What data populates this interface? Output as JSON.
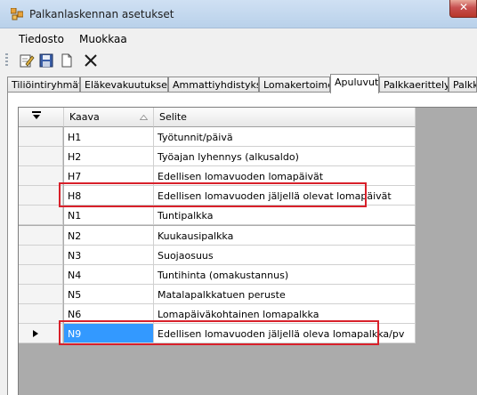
{
  "window": {
    "title": "Palkanlaskennan asetukset"
  },
  "menu": [
    "Tiedosto",
    "Muokkaa"
  ],
  "toolbar": [
    {
      "icon": "edit-icon"
    },
    {
      "icon": "save-icon"
    },
    {
      "icon": "new-document-icon"
    },
    {
      "icon": "delete-icon"
    }
  ],
  "tabs": [
    {
      "label": "Tiliöintiryhmät",
      "active": false
    },
    {
      "label": "Eläkevakuutukset",
      "active": false
    },
    {
      "label": "Ammattiyhdistykset",
      "active": false
    },
    {
      "label": "Lomakertoimet",
      "active": false
    },
    {
      "label": "Apuluvut",
      "active": true
    },
    {
      "label": "Palkkaerittely",
      "active": false
    },
    {
      "label": "Palkka",
      "active": false
    }
  ],
  "grid": {
    "columns": [
      {
        "label": "Kaava",
        "sort": "ascending"
      },
      {
        "label": "Selite"
      }
    ],
    "rows": [
      {
        "kaava": "H1",
        "selite": "Työtunnit/päivä"
      },
      {
        "kaava": "H2",
        "selite": "Työajan lyhennys (alkusaldo)"
      },
      {
        "kaava": "H7",
        "selite": "Edellisen lomavuoden lomapäivät"
      },
      {
        "kaava": "H8",
        "selite": "Edellisen lomavuoden jäljellä olevat lomapäivät",
        "highlighted": true
      },
      {
        "kaava": "N1",
        "selite": "Tuntipalkka"
      },
      {
        "kaava": "N2",
        "selite": "Kuukausipalkka"
      },
      {
        "kaava": "N3",
        "selite": "Suojaosuus"
      },
      {
        "kaava": "N4",
        "selite": "Tuntihinta (omakustannus)"
      },
      {
        "kaava": "N5",
        "selite": "Matalapalkkatuen peruste"
      },
      {
        "kaava": "N6",
        "selite": "Lomapäiväkohtainen lomapalkka"
      },
      {
        "kaava": "N9",
        "selite": "Edellisen lomavuoden jäljellä oleva lomapalkka/pv",
        "highlighted": true,
        "current": true
      }
    ]
  },
  "colors": {
    "highlight": "#d8202a",
    "selection": "#3399ff",
    "grid_background": "#ababab"
  }
}
